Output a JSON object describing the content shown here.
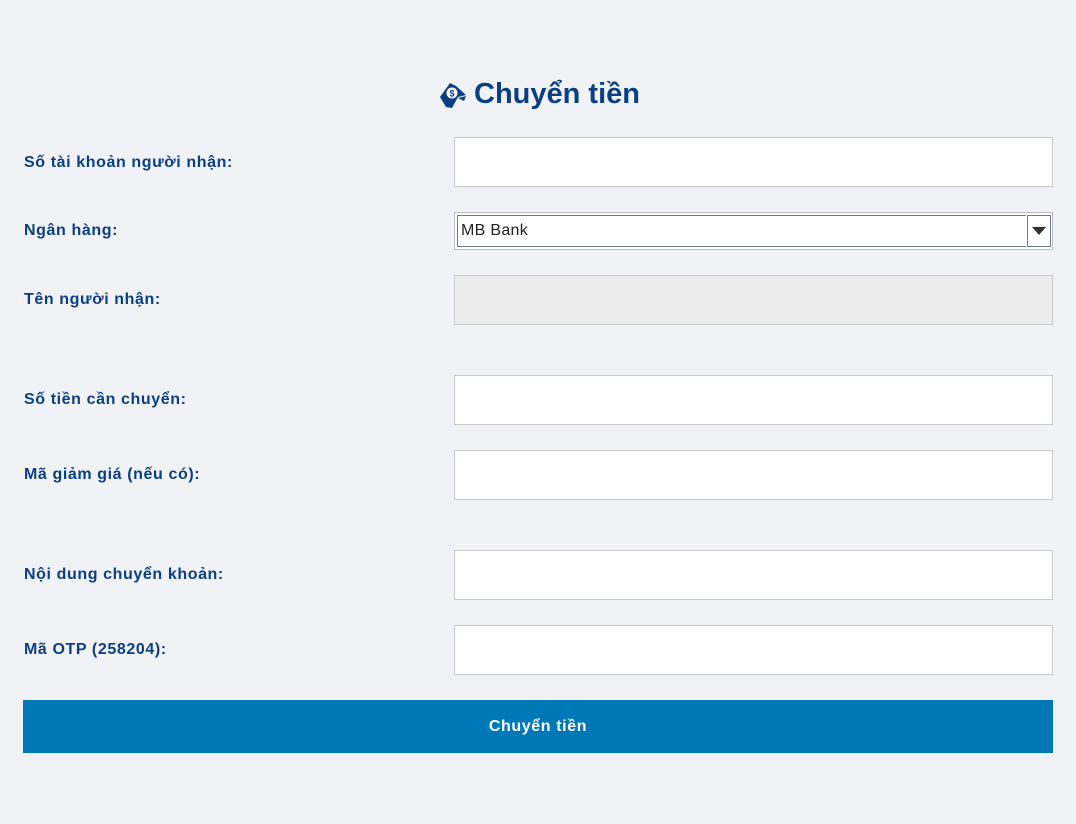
{
  "header": {
    "title": "Chuyển tiền",
    "icon": "money-transfer-icon"
  },
  "form": {
    "account_number": {
      "label": "Số tài khoản người nhận:",
      "value": "",
      "placeholder": ""
    },
    "bank": {
      "label": "Ngân hàng:",
      "selected": "MB Bank"
    },
    "recipient_name": {
      "label": "Tên người nhận:",
      "value": ""
    },
    "amount": {
      "label": "Số tiền cần chuyển:",
      "value": "",
      "placeholder": ""
    },
    "discount_code": {
      "label": "Mã giảm giá (nếu có):",
      "value": "",
      "placeholder": ""
    },
    "transfer_note": {
      "label": "Nội dung chuyển khoản:",
      "value": "",
      "placeholder": ""
    },
    "otp": {
      "label": "Mã OTP (258204):",
      "value": "",
      "placeholder": ""
    },
    "submit_label": "Chuyển tiền"
  },
  "colors": {
    "background": "#f0f2f6",
    "label": "#0a3f82",
    "button": "#0077b6",
    "disabled_field": "#ececec"
  }
}
